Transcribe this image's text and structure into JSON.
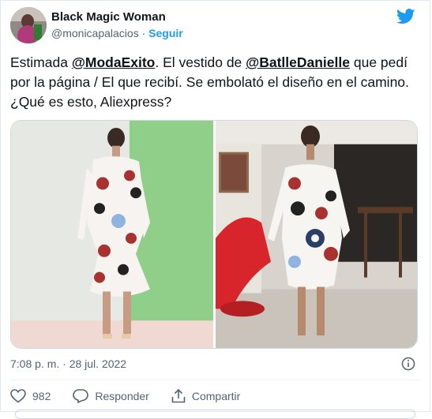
{
  "author": {
    "name": "Black Magic Woman",
    "handle": "@monicapalacios",
    "separator": "·",
    "follow_label": "Seguir"
  },
  "tweet": {
    "part1": "Estimada ",
    "mention1": "@ModaExito",
    "part2": ". El vestido de ",
    "mention2": "@BatlleDanielle",
    "part3": " que pedí por la página / El que recibí. Se embolató el diseño en el camino. ¿Qué es esto, Aliexpress?"
  },
  "timestamp": "7:08 p. m. · 28 jul. 2022",
  "actions": {
    "like_count": "982",
    "reply_label": "Responder",
    "share_label": "Compartir"
  },
  "colors": {
    "accent": "#1d9bf0",
    "text": "#0f1419",
    "secondary": "#536471"
  }
}
